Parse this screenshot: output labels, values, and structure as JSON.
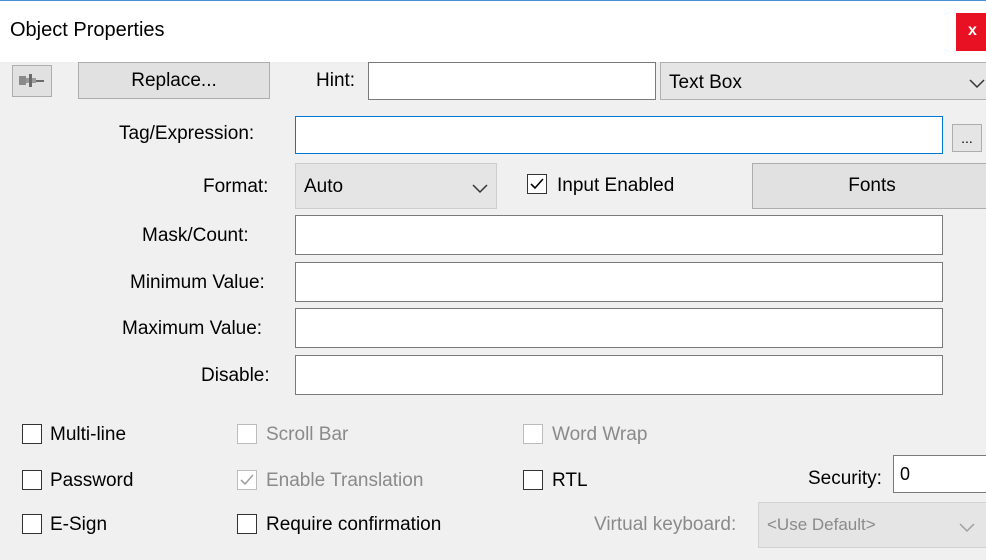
{
  "window": {
    "title": "Object Properties",
    "close_label": "x"
  },
  "toolbar": {
    "pin_icon": "pushpin-icon",
    "replace_label": "Replace...",
    "hint_label": "Hint:",
    "hint_value": "",
    "object_type": "Text Box"
  },
  "tag": {
    "label": "Tag/Expression:",
    "value": "",
    "browse_label": "..."
  },
  "format": {
    "label": "Format:",
    "value": "Auto",
    "input_enabled_label": "Input Enabled",
    "input_enabled_checked": true,
    "fonts_label": "Fonts"
  },
  "fields": {
    "mask_label": "Mask/Count:",
    "mask_value": "",
    "min_label": "Minimum Value:",
    "min_value": "",
    "max_label": "Maximum Value:",
    "max_value": "",
    "disable_label": "Disable:",
    "disable_value": ""
  },
  "options": {
    "multiline_label": "Multi-line",
    "multiline_checked": false,
    "scrollbar_label": "Scroll Bar",
    "scrollbar_checked": false,
    "wordwrap_label": "Word Wrap",
    "wordwrap_checked": false,
    "password_label": "Password",
    "password_checked": false,
    "translation_label": "Enable Translation",
    "translation_checked": true,
    "rtl_label": "RTL",
    "rtl_checked": false,
    "security_label": "Security:",
    "security_value": "0",
    "esign_label": "E-Sign",
    "esign_checked": false,
    "confirm_label": "Require confirmation",
    "confirm_checked": false,
    "vk_label": "Virtual keyboard:",
    "vk_value": "<Use Default>"
  },
  "colors": {
    "close": "#e81123",
    "focus_border": "#0078d7",
    "dialog_bg": "#f0f0f0",
    "disabled_text": "#8a8a8a"
  }
}
